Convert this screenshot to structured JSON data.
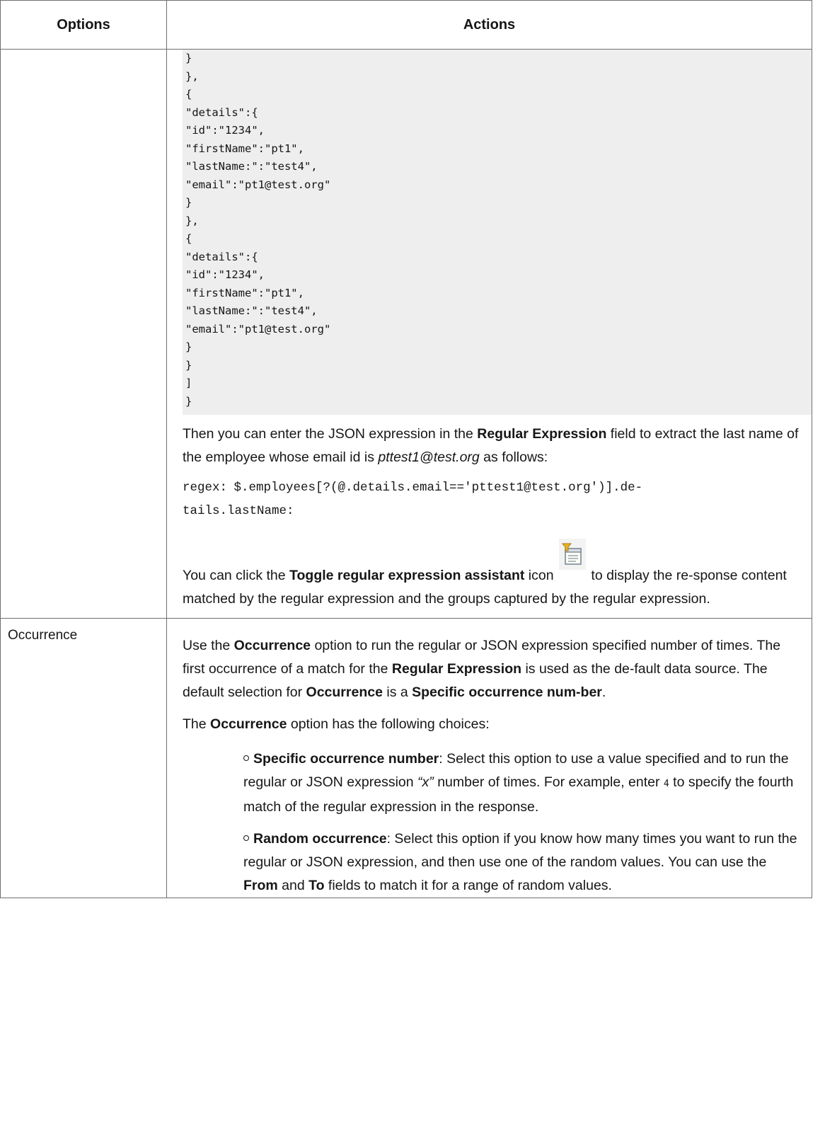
{
  "table": {
    "header_options": "Options",
    "header_actions": "Actions"
  },
  "row1": {
    "code_lines": [
      "}",
      "},",
      "{",
      "\"details\":{",
      "\"id\":\"1234\",",
      "\"firstName\":\"pt1\",",
      "\"lastName:\":\"test4\",",
      "\"email\":\"pt1@test.org\"",
      "}",
      "},",
      "{",
      "\"details\":{",
      "\"id\":\"1234\",",
      "\"firstName\":\"pt1\",",
      "\"lastName:\":\"test4\",",
      "\"email\":\"pt1@test.org\"",
      "}",
      "}",
      "]",
      "}"
    ],
    "then_text_1": "Then you can enter the JSON expression in the ",
    "then_bold": "Regular Expression",
    "then_text_2": " field to extract the last name of the employee whose email id is ",
    "then_italic": "pttest1@test.org",
    "then_text_3": " as follows:",
    "regex_line_1": "regex: $.employees[?(@.details.email=='pttest1@test.org')].de-",
    "regex_line_2": "tails.lastName:",
    "toggle_text_1": "You can click the ",
    "toggle_bold": "Toggle regular expression assistant",
    "toggle_text_2": " icon ",
    "toggle_text_3": " to display the re-sponse content matched by the regular expression and the groups captured by the regular expression.",
    "toggle_icon": "toggle-regex-assistant-icon"
  },
  "row2": {
    "option_label": "Occurrence",
    "p1_a": "Use the ",
    "p1_b": "Occurrence",
    "p1_c": " option to run the regular or JSON expression specified number of times. The first occurrence of a match for the ",
    "p1_d": "Regular Expression",
    "p1_e": " is used as the de-fault data source. The default selection for ",
    "p1_f": "Occurrence",
    "p1_g": " is a ",
    "p1_h": "Specific occurrence num-ber",
    "p1_i": ".",
    "p2_a": "The ",
    "p2_b": "Occurrence",
    "p2_c": " option has the following choices:",
    "choices": [
      {
        "bold": "Specific occurrence number",
        "t1": ": Select this option to use a value specified and to run the regular or JSON expression ",
        "italic": "“x”",
        "t2": " number of times. For example, enter ",
        "code": "4",
        "t3": " to specify the fourth match of the regular expression in the response."
      },
      {
        "bold": "Random occurrence",
        "t1": ": Select this option if you know how many times you want to run the regular or JSON expression, and then use one of the random values. You can use the ",
        "bold2": "From",
        "t2": " and ",
        "bold3": "To",
        "t3": " fields to match it for a range of random values."
      }
    ]
  }
}
